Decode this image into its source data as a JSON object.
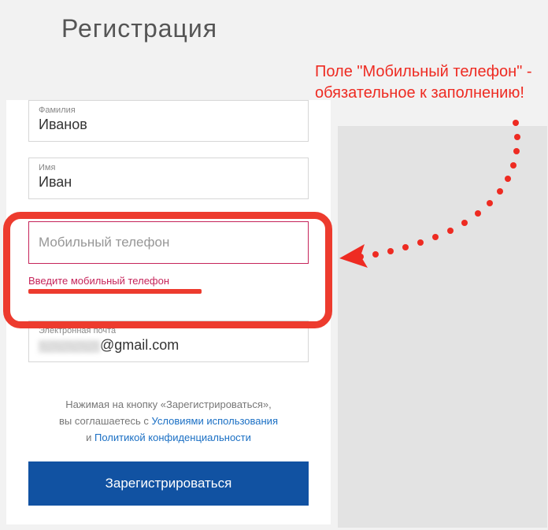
{
  "page_title": "Регистрация",
  "annotation": "Поле \"Мобильный телефон\" - обязательное к заполнению!",
  "fields": {
    "surname": {
      "label": "Фамилия",
      "value": "Иванов"
    },
    "name": {
      "label": "Имя",
      "value": "Иван"
    },
    "phone": {
      "placeholder": "Мобильный телефон",
      "error": "Введите мобильный телефон"
    },
    "email": {
      "label": "Электронная почта",
      "value_suffix": "@gmail.com"
    }
  },
  "agreement": {
    "line1_pre": "Нажимая на кнопку «Зарегистрироваться»,",
    "line2_pre": "вы соглашаетесь с ",
    "terms": "Условиями использования",
    "line3_pre": "и ",
    "privacy": "Политикой конфиденциальности"
  },
  "submit_label": "Зарегистрироваться"
}
